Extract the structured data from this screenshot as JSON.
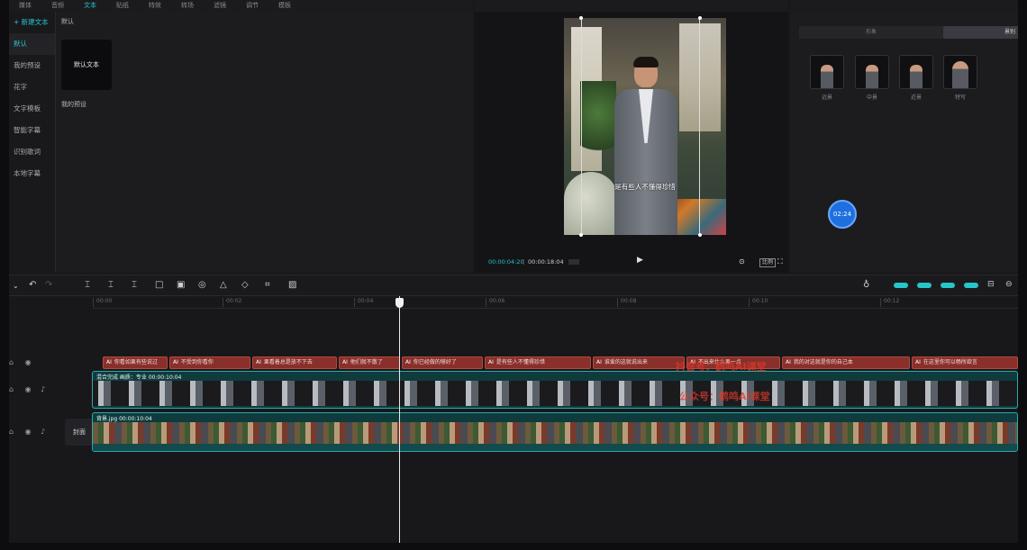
{
  "top_tabs": [
    {
      "label": "媒体"
    },
    {
      "label": "音频"
    },
    {
      "label": "文本",
      "active": true
    },
    {
      "label": "贴纸"
    },
    {
      "label": "特效"
    },
    {
      "label": "转场"
    },
    {
      "label": "滤镜"
    },
    {
      "label": "调节"
    },
    {
      "label": "模板"
    }
  ],
  "sidebar": {
    "items": [
      {
        "label": "+ 新建文本"
      },
      {
        "label": "默认"
      },
      {
        "label": "我的预设"
      },
      {
        "label": "花字"
      },
      {
        "label": "文字模板"
      },
      {
        "label": "智能字幕"
      },
      {
        "label": "识别歌词"
      },
      {
        "label": "本地字幕"
      }
    ]
  },
  "text_panel": {
    "section_default": "默认",
    "default_tile": "默认文本",
    "section_presets": "我的预设"
  },
  "player": {
    "caption": "是有些人不懂得珍惜",
    "current_time": "00:00:04:20",
    "separator": "|",
    "total_time": "00:00:18:04",
    "ratio_label": "比例"
  },
  "right_panel": {
    "segment_left": "形象",
    "segment_right": "景别",
    "shots": [
      {
        "label": "远景"
      },
      {
        "label": "中景"
      },
      {
        "label": "近景"
      },
      {
        "label": "特写"
      }
    ]
  },
  "timer_badge": "02:24",
  "ruler_ticks": [
    "00:00",
    "00:02",
    "00:04",
    "00:06",
    "00:08",
    "00:10",
    "00:12"
  ],
  "cover_label": "封面",
  "text_clips": [
    {
      "tag": "AI",
      "text": "你看如果有些说过"
    },
    {
      "tag": "AI",
      "text": "不受到你看你"
    },
    {
      "tag": "AI",
      "text": "果看着总是放不下去"
    },
    {
      "tag": "AI",
      "text": "他们就不散了"
    },
    {
      "tag": "AI",
      "text": "你已经做的够好了"
    },
    {
      "tag": "AI",
      "text": "是有些人不懂得珍惜"
    },
    {
      "tag": "AI",
      "text": "谁爱的这就说出来"
    },
    {
      "tag": "AI",
      "text": "不出来什么果一点"
    },
    {
      "tag": "AI",
      "text": "我的对这就是你的自己本"
    },
    {
      "tag": "AI",
      "text": "在这里你可以畅所欲言"
    }
  ],
  "video_clip": {
    "label": "混合完成  画质：专业  00:00:10:04"
  },
  "bg_clip": {
    "label": "背景.jpg  00:00:10:04"
  },
  "watermarks": [
    "抖音号：鹤鸣AI课堂",
    "公众号：鹤鸣AI课堂"
  ],
  "colors": {
    "accent": "#27c4c9",
    "text_clip": "#8a2f2a",
    "video_clip": "#0f3b3d",
    "badge": "#1e6fe0"
  }
}
